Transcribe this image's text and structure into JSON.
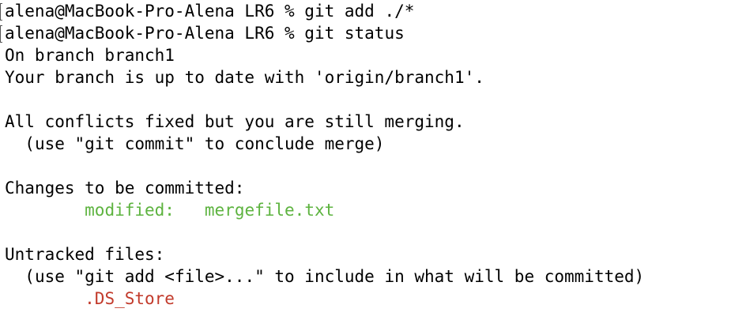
{
  "terminal": {
    "prompt": "alena@MacBook-Pro-Alena LR6 % ",
    "commands": [
      "git add ./*",
      "git status"
    ],
    "status": {
      "branch_line": "On branch branch1",
      "upstream_line": "Your branch is up to date with 'origin/branch1'.",
      "merge_line": "All conflicts fixed but you are still merging.",
      "merge_hint": "(use \"git commit\" to conclude merge)",
      "staged_header": "Changes to be committed:",
      "staged_change_type": "modified:",
      "staged_file": "mergefile.txt",
      "untracked_header": "Untracked files:",
      "untracked_hint": "(use \"git add <file>...\" to include in what will be committed)",
      "untracked_file": ".DS_Store"
    },
    "colors": {
      "staged": "#5db33f",
      "untracked": "#c23a2b",
      "text": "#000000",
      "background": "#ffffff"
    }
  }
}
